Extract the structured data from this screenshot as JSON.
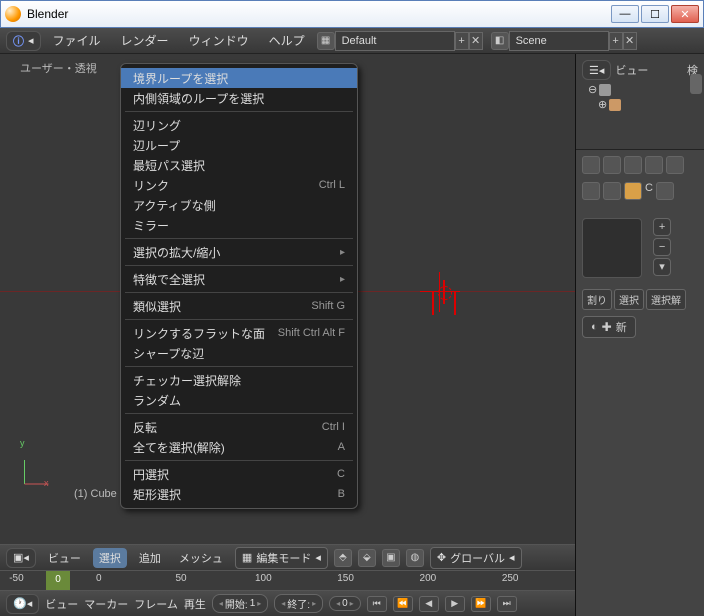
{
  "window": {
    "title": "Blender"
  },
  "menubar": {
    "file": "ファイル",
    "render": "レンダー",
    "window": "ウィンドウ",
    "help": "ヘルプ",
    "layout": "Default",
    "scene": "Scene"
  },
  "viewport": {
    "label_prefix": "ユーザー・透視",
    "object": "(1) Cube",
    "axis_x": "x",
    "axis_y": "y"
  },
  "context_menu": {
    "items": [
      {
        "label": "境界ループを選択",
        "hl": true
      },
      {
        "label": "内側領域のループを選択"
      },
      {
        "sep": true
      },
      {
        "label": "辺リング"
      },
      {
        "label": "辺ループ"
      },
      {
        "label": "最短パス選択"
      },
      {
        "label": "リンク",
        "shortcut": "Ctrl L"
      },
      {
        "label": "アクティブな側"
      },
      {
        "label": "ミラー"
      },
      {
        "sep": true
      },
      {
        "label": "選択の拡大/縮小",
        "sub": true
      },
      {
        "sep": true
      },
      {
        "label": "特徴で全選択",
        "sub": true
      },
      {
        "sep": true
      },
      {
        "label": "類似選択",
        "shortcut": "Shift G"
      },
      {
        "sep": true
      },
      {
        "label": "リンクするフラットな面",
        "shortcut": "Shift Ctrl Alt F"
      },
      {
        "label": "シャープな辺"
      },
      {
        "sep": true
      },
      {
        "label": "チェッカー選択解除"
      },
      {
        "label": "ランダム"
      },
      {
        "sep": true
      },
      {
        "label": "反転",
        "shortcut": "Ctrl I"
      },
      {
        "label": "全てを選択(解除)",
        "shortcut": "A"
      },
      {
        "sep": true
      },
      {
        "label": "円選択",
        "shortcut": "C"
      },
      {
        "label": "矩形選択",
        "shortcut": "B"
      }
    ]
  },
  "vp_header": {
    "view": "ビュー",
    "select": "選択",
    "add": "追加",
    "mesh": "メッシュ",
    "mode": "編集モード",
    "orientation": "グローバル"
  },
  "ruler": {
    "ticks": [
      -50,
      0,
      50,
      100,
      150,
      200,
      250
    ],
    "current": 0
  },
  "timeline": {
    "view": "ビュー",
    "marker": "マーカー",
    "frame": "フレーム",
    "playback": "再生",
    "start_label": "開始:",
    "start": 1,
    "end_label": "終了:",
    "curr": 0
  },
  "outliner": {
    "header": "ビュー",
    "search": "検"
  },
  "props": {
    "obj_name": "C",
    "assign": "割り",
    "select": "選択",
    "deselect": "選択解",
    "new": "新"
  }
}
